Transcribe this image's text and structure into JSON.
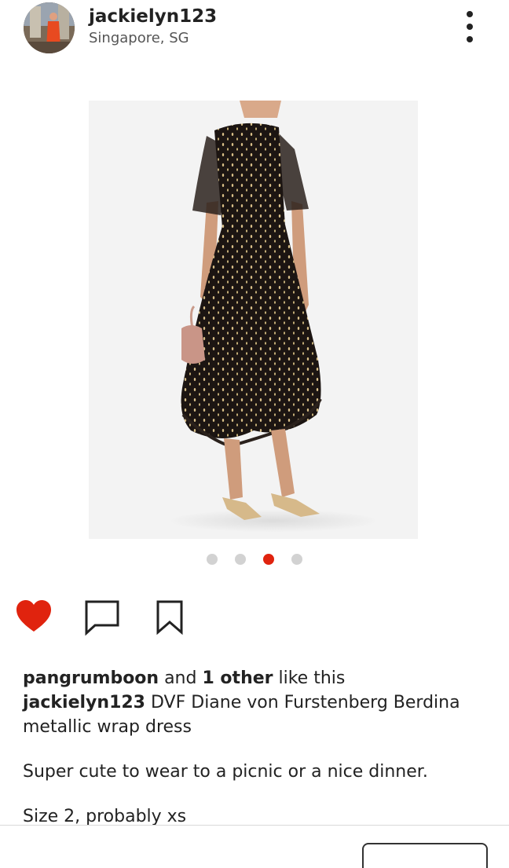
{
  "post": {
    "username": "jackielyn123",
    "location": "Singapore, SG"
  },
  "carousel": {
    "count": 4,
    "active_index": 3
  },
  "likes": {
    "first_user": "pangrumboon",
    "and_text": "and",
    "others": "1 other",
    "suffix": "like this"
  },
  "caption": {
    "author": "jackielyn123",
    "title": "DVF Diane von Furstenberg Berdina metallic wrap dress",
    "line1": "Super cute to wear to a picnic or a nice dinner.",
    "line2": "Size 2, probably xs"
  },
  "colors": {
    "accent": "#e0230e",
    "dot_inactive": "#d2d2d2",
    "dress": "#1c1512"
  },
  "icons": [
    "more-vertical-icon",
    "heart-icon",
    "comment-icon",
    "bookmark-icon"
  ]
}
